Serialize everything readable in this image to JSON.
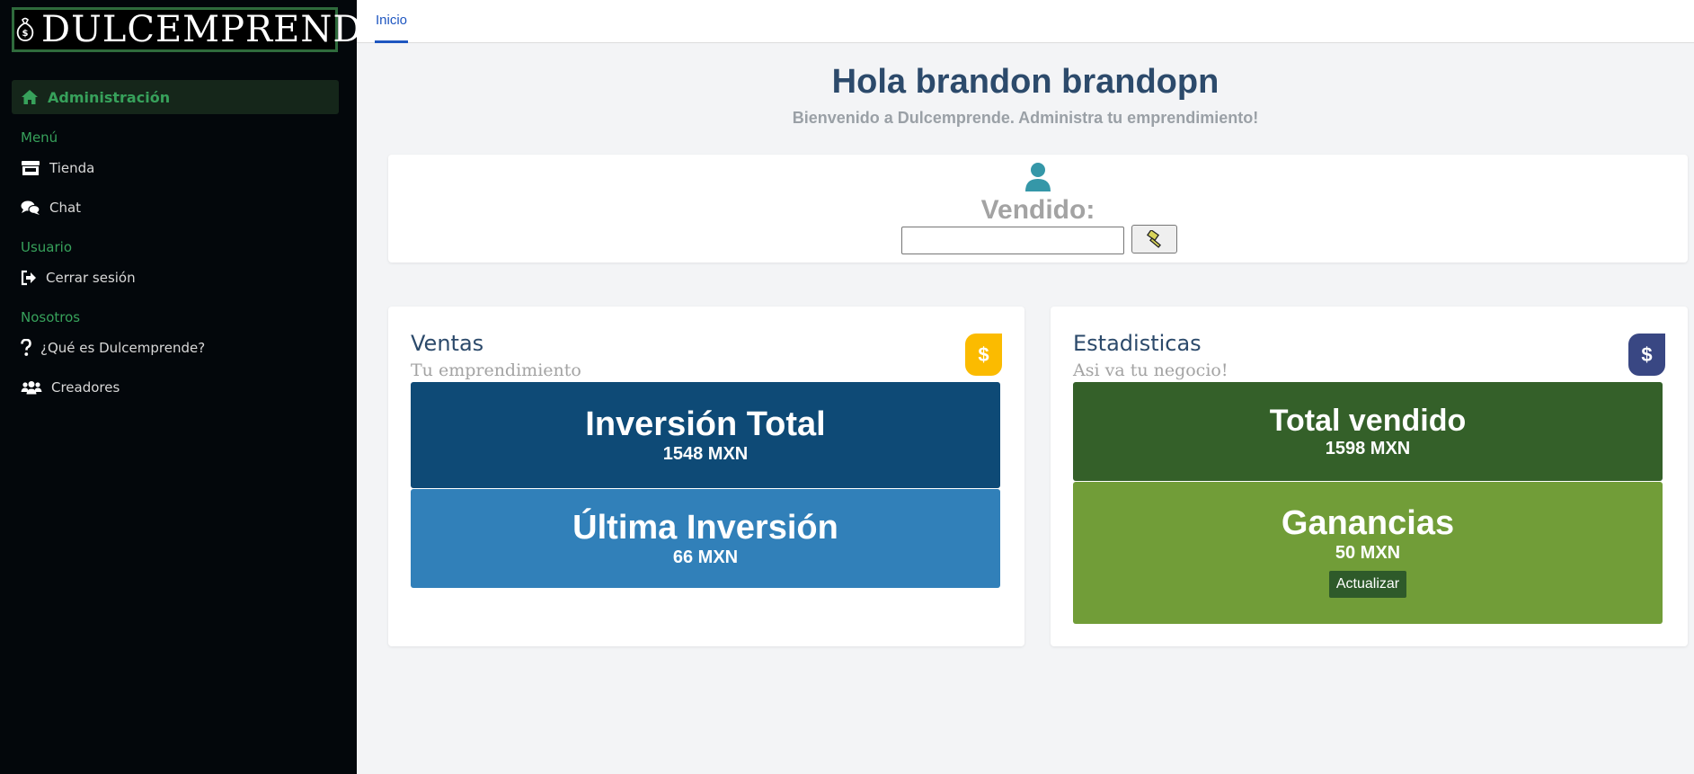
{
  "app": {
    "logo_text": "DULCEMPRENDE"
  },
  "sidebar": {
    "active_item": {
      "label": "Administración",
      "icon": "home-icon"
    },
    "sections": [
      {
        "heading": "Menú",
        "items": [
          {
            "label": "Tienda",
            "icon": "store-icon"
          },
          {
            "label": "Chat",
            "icon": "chat-icon"
          }
        ]
      },
      {
        "heading": "Usuario",
        "items": [
          {
            "label": "Cerrar sesión",
            "icon": "sign-out-icon"
          }
        ]
      },
      {
        "heading": "Nosotros",
        "items": [
          {
            "label": "¿Qué es Dulcemprende?",
            "icon": "question-icon"
          },
          {
            "label": "Creadores",
            "icon": "users-icon"
          }
        ]
      }
    ]
  },
  "tabs": [
    {
      "label": "Inicio",
      "active": true
    }
  ],
  "header": {
    "greeting": "Hola brandon brandopn",
    "subtitle": "Bienvenido a Dulcemprende. Administra tu emprendimiento!"
  },
  "vendido": {
    "label": "Vendido:",
    "input_value": "",
    "icon": "user-icon",
    "button_icon": "hammer-icon"
  },
  "ventas": {
    "title": "Ventas",
    "subtitle": "Tu emprendimiento",
    "badge": "$",
    "inversion_total": {
      "label": "Inversión Total",
      "value": "1548 MXN"
    },
    "ultima_inversion": {
      "label": "Última Inversión",
      "value": "66 MXN"
    }
  },
  "estadisticas": {
    "title": "Estadisticas",
    "subtitle": "Asi va tu negocio!",
    "badge": "$",
    "total_vendido": {
      "label": "Total vendido",
      "value": "1598 MXN"
    },
    "ganancias": {
      "label": "Ganancias",
      "value": "50 MXN",
      "button": "Actualizar"
    }
  },
  "colors": {
    "sidebar_bg": "#03070b",
    "accent_green": "#37a15b",
    "heading_blue": "#2c4a6b",
    "inversion_total_bg": "#0e4a76",
    "ultima_inversion_bg": "#3180b9",
    "total_vendido_bg": "#346029",
    "ganancias_bg": "#719d38",
    "badge_yellow": "#fbbb00",
    "badge_indigo": "#394783"
  }
}
